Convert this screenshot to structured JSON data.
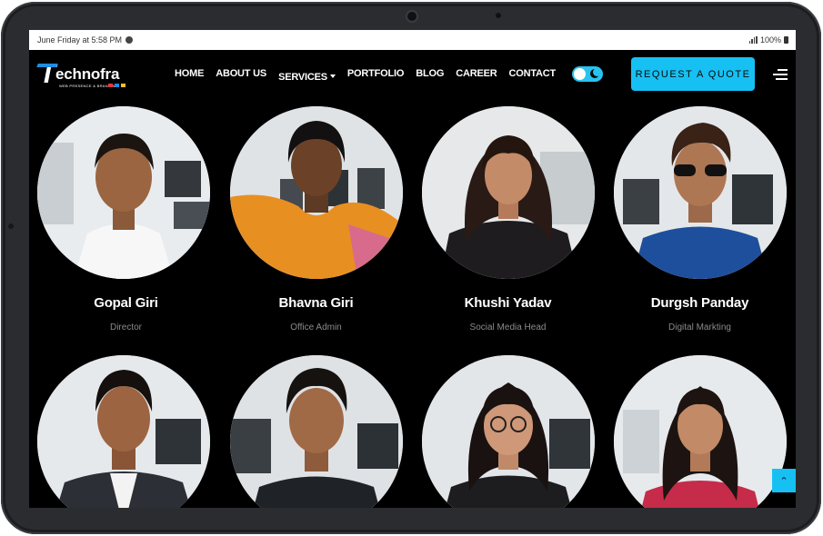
{
  "status": {
    "datetime": "June Friday at 5:58 PM",
    "battery": "100%"
  },
  "brand": {
    "name": "echnofra",
    "initial": "T",
    "tagline": "WEB PRESENCE & BRANDING"
  },
  "nav": {
    "items": [
      "HOME",
      "ABOUT US",
      "SERVICES",
      "PORTFOLIO",
      "BLOG",
      "CAREER",
      "CONTACT"
    ],
    "services_has_dropdown": true
  },
  "cta": {
    "label": "REQUEST A QUOTE"
  },
  "colors": {
    "accent": "#17c0f2",
    "background": "#000000",
    "role_text": "#8b8b8b"
  },
  "team": [
    {
      "name": "Gopal Giri",
      "role": "Director"
    },
    {
      "name": "Bhavna Giri",
      "role": "Office Admin"
    },
    {
      "name": "Khushi Yadav",
      "role": "Social Media Head"
    },
    {
      "name": "Durgsh Panday",
      "role": "Digital Markting"
    },
    {
      "name": "",
      "role": ""
    },
    {
      "name": "",
      "role": ""
    },
    {
      "name": "",
      "role": ""
    },
    {
      "name": "",
      "role": ""
    }
  ],
  "icons": {
    "theme_toggle": "moon-toggle-icon",
    "menu": "hamburger-icon",
    "scroll_top": "chevron-double-up-icon"
  }
}
